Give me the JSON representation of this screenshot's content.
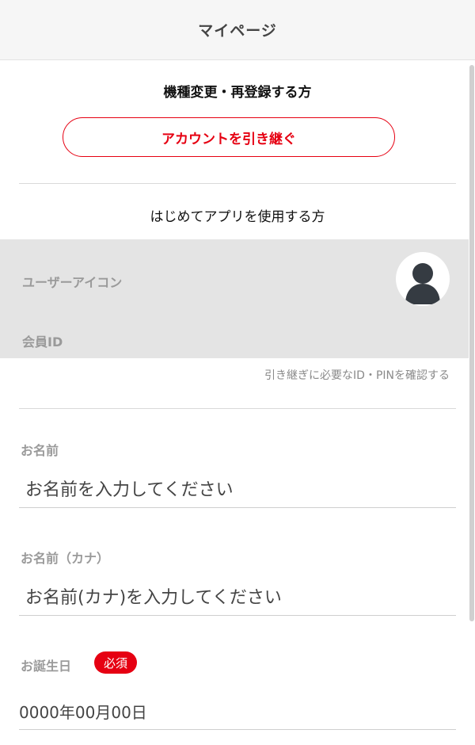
{
  "header": {
    "title": "マイページ"
  },
  "transfer": {
    "heading": "機種変更・再登録する方",
    "button_label": "アカウントを引き継ぐ"
  },
  "first_time": {
    "heading": "はじめてアプリを使用する方"
  },
  "profile": {
    "icon_label": "ユーザーアイコン",
    "member_id_label": "会員ID",
    "confirm_link": "引き継ぎに必要なID・PINを確認する"
  },
  "form": {
    "name_label": "お名前",
    "name_placeholder": "お名前を入力してください",
    "kana_label": "お名前（カナ）",
    "kana_placeholder": "お名前(カナ)を入力してください",
    "birth_label": "お誕生日",
    "required_badge": "必須",
    "birth_placeholder": "0000年00月00日"
  },
  "colors": {
    "accent": "#e60012",
    "panel_bg": "#e4e4e4",
    "avatar": "#353b42"
  }
}
